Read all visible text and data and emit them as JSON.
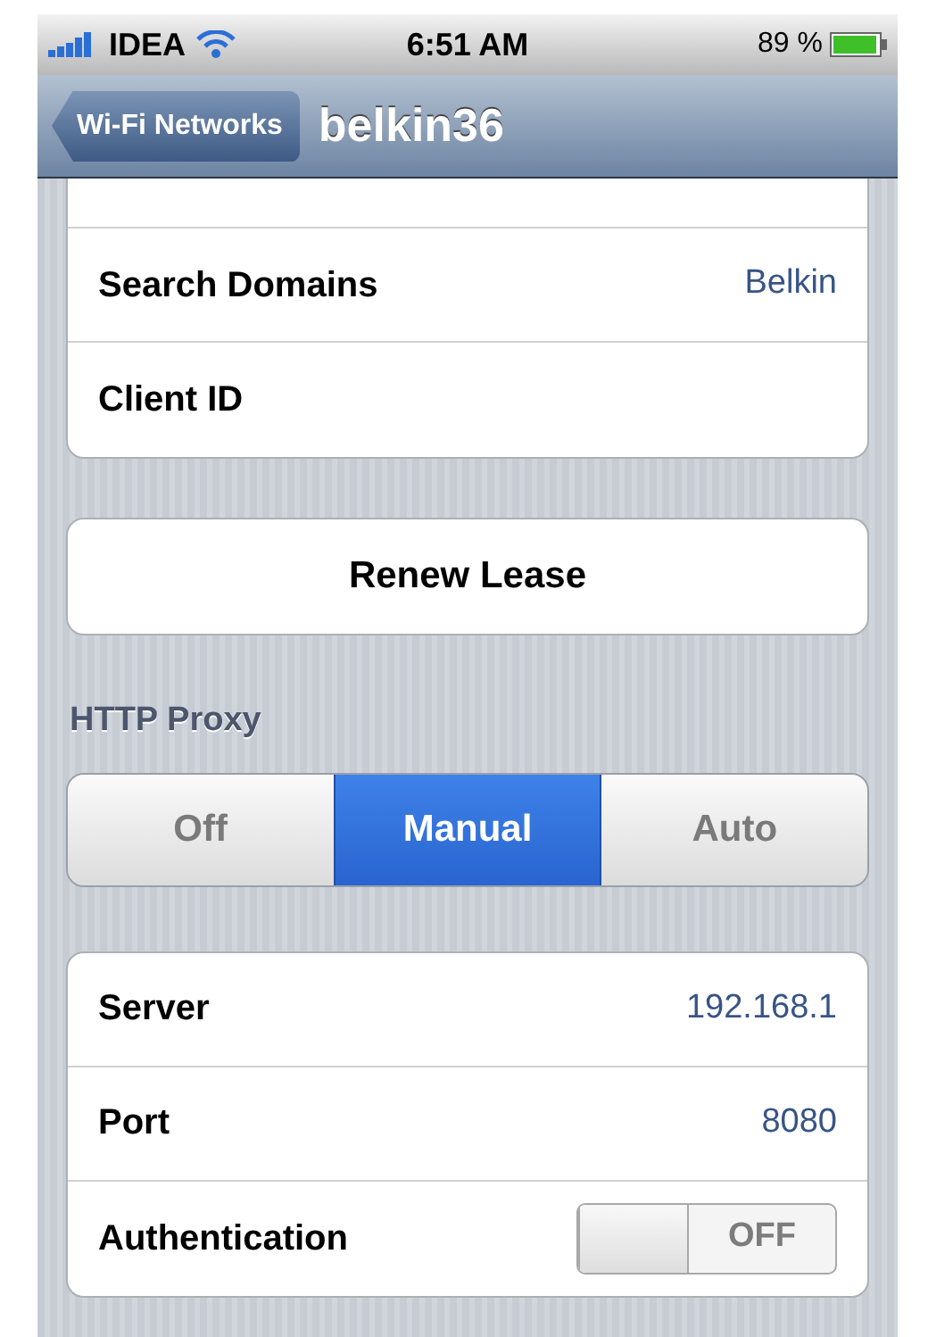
{
  "status_bar": {
    "carrier": "IDEA",
    "time": "6:51 AM",
    "battery": "89 %"
  },
  "nav_bar": {
    "back": "Wi-Fi Networks",
    "title": "belkin36"
  },
  "dhcp_rows": [
    {
      "label": "Search Domains",
      "value": "Belkin"
    },
    {
      "label": "Client ID"
    }
  ],
  "renew_button": "Renew Lease",
  "proxy_header": "HTTP Proxy",
  "proxy_modes": [
    {
      "label": "Off",
      "selected": false
    },
    {
      "label": "Manual",
      "selected": true
    },
    {
      "label": "Auto",
      "selected": false
    }
  ],
  "proxy_rows": [
    {
      "kind": "value",
      "label": "Server",
      "value": "192.168.1"
    },
    {
      "kind": "value",
      "label": "Port",
      "value": "8080"
    },
    {
      "kind": "switch",
      "label": "Authentication",
      "on": false,
      "switch_label": "OFF"
    }
  ]
}
